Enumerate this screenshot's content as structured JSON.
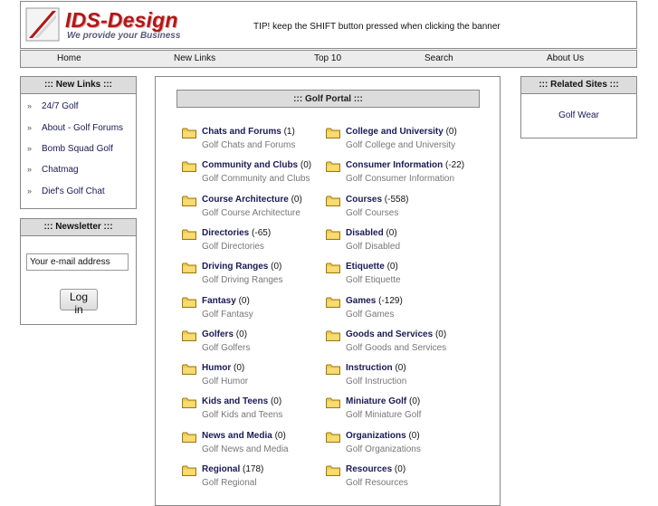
{
  "header": {
    "logo_title": "IDS-Design",
    "logo_tagline": "We provide your Business",
    "tip": "TIP! keep the SHIFT button pressed when clicking the banner"
  },
  "nav": {
    "home": "Home",
    "new_links": "New Links",
    "top10": "Top 10",
    "search": "Search",
    "about": "About Us"
  },
  "new_links": {
    "title": "::: New Links :::",
    "items": [
      "24/7 Golf",
      "About - Golf Forums",
      "Bomb Squad Golf",
      "Chatmag",
      "Dief's Golf Chat"
    ]
  },
  "newsletter": {
    "title": "::: Newsletter :::",
    "email_value": "Your e-mail address",
    "login_label": "Log in"
  },
  "portal": {
    "title": "::: Golf Portal :::",
    "categories": [
      {
        "name": "Chats and Forums",
        "count": "(1)",
        "desc": "Golf Chats and Forums"
      },
      {
        "name": "College and University",
        "count": "(0)",
        "desc": "Golf College and University"
      },
      {
        "name": "Community and Clubs",
        "count": "(0)",
        "desc": "Golf Community and Clubs"
      },
      {
        "name": "Consumer Information",
        "count": "(-22)",
        "desc": "Golf Consumer Information"
      },
      {
        "name": "Course Architecture",
        "count": "(0)",
        "desc": "Golf Course Architecture"
      },
      {
        "name": "Courses",
        "count": "(-558)",
        "desc": "Golf Courses"
      },
      {
        "name": "Directories",
        "count": "(-65)",
        "desc": "Golf Directories"
      },
      {
        "name": "Disabled",
        "count": "(0)",
        "desc": "Golf Disabled"
      },
      {
        "name": "Driving Ranges",
        "count": "(0)",
        "desc": "Golf Driving Ranges"
      },
      {
        "name": "Etiquette",
        "count": "(0)",
        "desc": "Golf Etiquette"
      },
      {
        "name": "Fantasy",
        "count": "(0)",
        "desc": "Golf Fantasy"
      },
      {
        "name": "Games",
        "count": "(-129)",
        "desc": "Golf Games"
      },
      {
        "name": "Golfers",
        "count": "(0)",
        "desc": "Golf Golfers"
      },
      {
        "name": "Goods and Services",
        "count": "(0)",
        "desc": "Golf Goods and Services"
      },
      {
        "name": "Humor",
        "count": "(0)",
        "desc": "Golf Humor"
      },
      {
        "name": "Instruction",
        "count": "(0)",
        "desc": "Golf Instruction"
      },
      {
        "name": "Kids and Teens",
        "count": "(0)",
        "desc": "Golf Kids and Teens"
      },
      {
        "name": "Miniature Golf",
        "count": "(0)",
        "desc": "Golf Miniature Golf"
      },
      {
        "name": "News and Media",
        "count": "(0)",
        "desc": "Golf News and Media"
      },
      {
        "name": "Organizations",
        "count": "(0)",
        "desc": "Golf Organizations"
      },
      {
        "name": "Regional",
        "count": "(178)",
        "desc": "Golf Regional"
      },
      {
        "name": "Resources",
        "count": "(0)",
        "desc": "Golf Resources"
      }
    ]
  },
  "related": {
    "title": "::: Related Sites :::",
    "link": "Golf Wear"
  },
  "colors": {
    "logo_red": "#b01818",
    "link_navy": "#1a1a55",
    "folder_yellow": "#f2cc4a",
    "panel_gray": "#dcdcdc"
  },
  "icons": {
    "category": "folder-icon",
    "list_bullet": "double-chevron-icon"
  }
}
